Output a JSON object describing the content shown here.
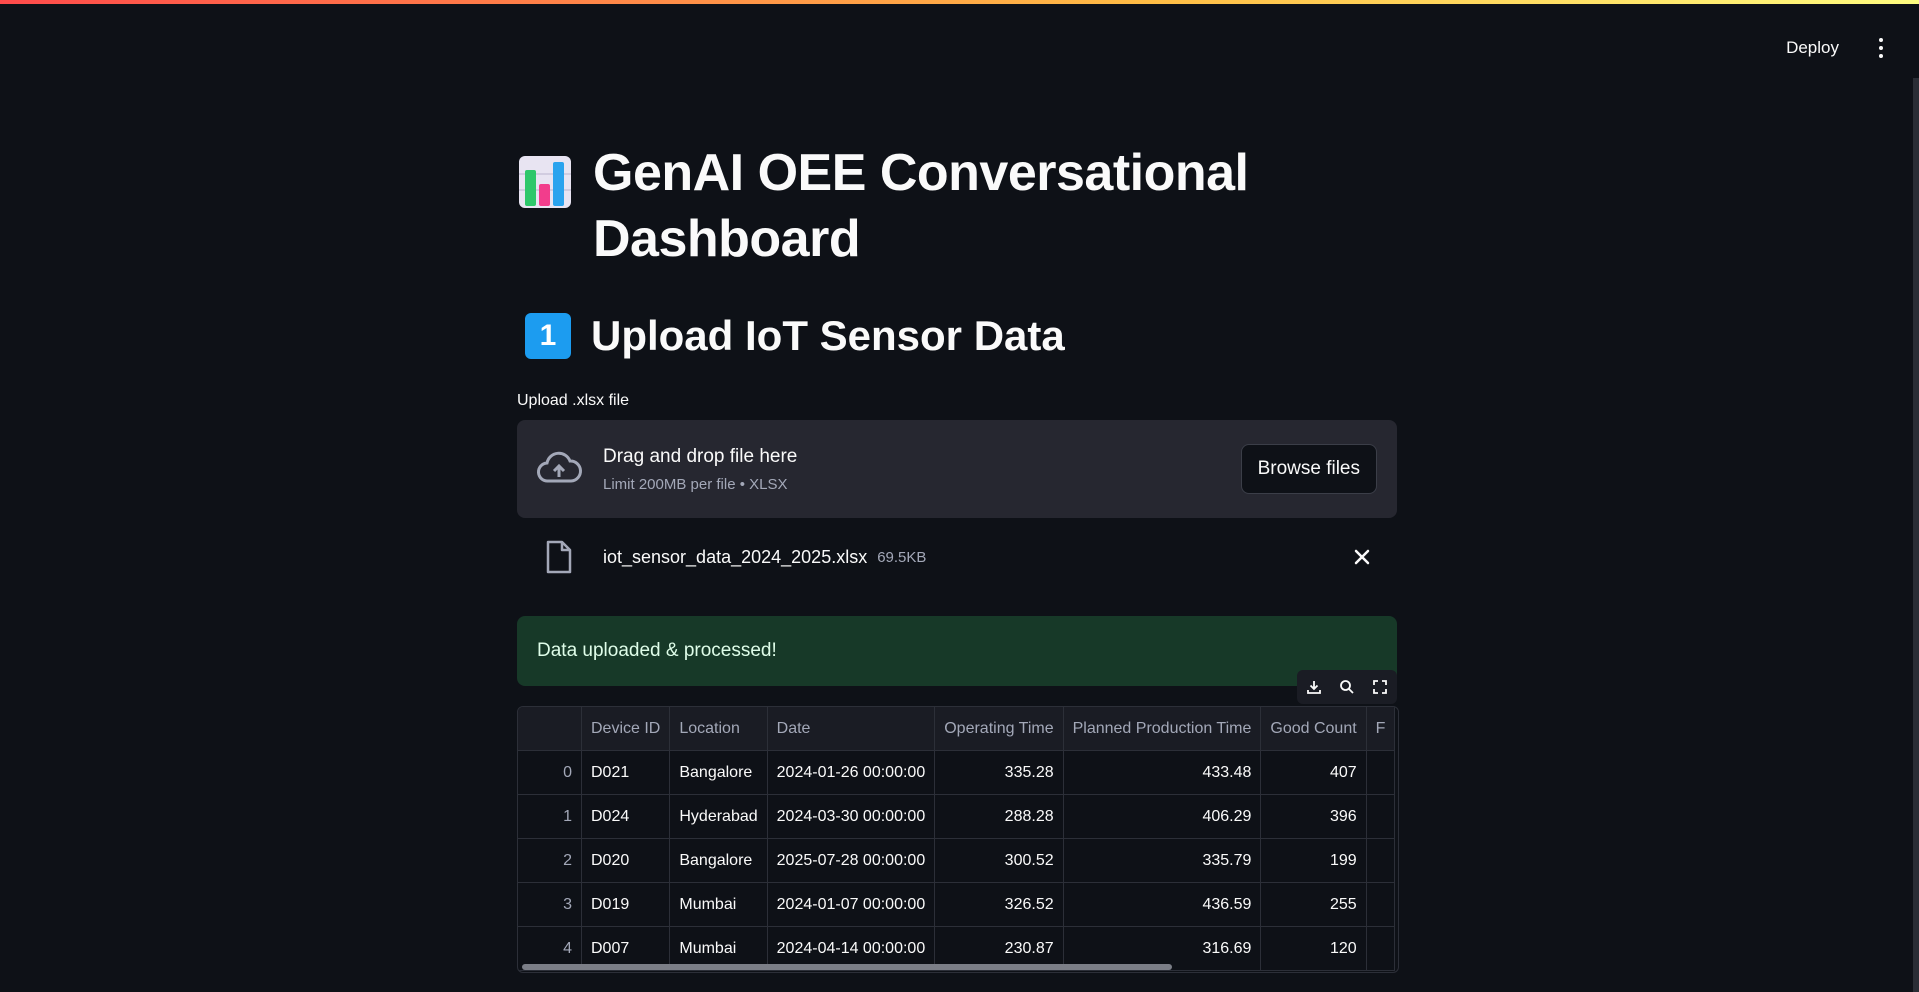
{
  "header": {
    "deploy_label": "Deploy",
    "menu_icon": "kebab-menu-icon"
  },
  "main": {
    "title": "GenAI OEE Conversational Dashboard",
    "title_icon": "bar-chart-icon",
    "section_badge": "1",
    "section_title": "Upload IoT Sensor Data",
    "upload": {
      "label": "Upload .xlsx file",
      "drop_text": "Drag and drop file here",
      "limit_text": "Limit 200MB per file • XLSX",
      "browse_label": "Browse files",
      "file_name": "iot_sensor_data_2024_2025.xlsx",
      "file_size": "69.5KB"
    },
    "success_message": "Data uploaded & processed!",
    "table": {
      "columns": [
        "",
        "Device ID",
        "Location",
        "Date",
        "Operating Time",
        "Planned Production Time",
        "Good Count",
        "F"
      ],
      "rows": [
        [
          "0",
          "D021",
          "Bangalore",
          "2024-01-26 00:00:00",
          "335.28",
          "433.48",
          "407",
          ""
        ],
        [
          "1",
          "D024",
          "Hyderabad",
          "2024-03-30 00:00:00",
          "288.28",
          "406.29",
          "396",
          ""
        ],
        [
          "2",
          "D020",
          "Bangalore",
          "2025-07-28 00:00:00",
          "300.52",
          "335.79",
          "199",
          ""
        ],
        [
          "3",
          "D019",
          "Mumbai",
          "2024-01-07 00:00:00",
          "326.52",
          "436.59",
          "255",
          ""
        ],
        [
          "4",
          "D007",
          "Mumbai",
          "2024-04-14 00:00:00",
          "230.87",
          "316.69",
          "120",
          ""
        ]
      ]
    }
  },
  "colors": {
    "accent": "#1c9cf0",
    "success_bg": "#173928",
    "background": "#0e1117"
  }
}
